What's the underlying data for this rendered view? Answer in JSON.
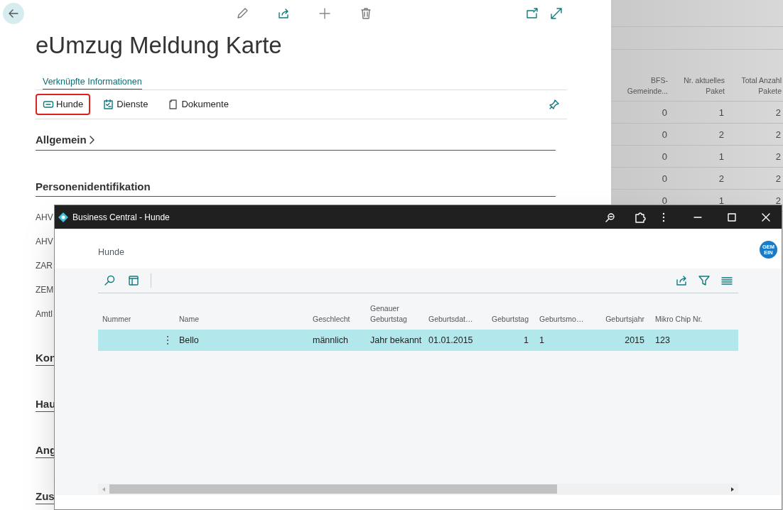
{
  "page": {
    "title": "eUmzug Meldung Karte",
    "related_link": "Verknüpfte Informationen",
    "actions": [
      {
        "label": "Hunde",
        "kind": "tag",
        "highlighted": true
      },
      {
        "label": "Dienste",
        "kind": "services",
        "highlighted": false
      },
      {
        "label": "Dokumente",
        "kind": "docs",
        "highlighted": false
      }
    ],
    "sections": [
      {
        "title": "Allgemein",
        "expandable": true
      },
      {
        "title": "Personenidentifikation",
        "expandable": false
      }
    ],
    "fields": [
      "AHV",
      "AHV",
      "ZAR",
      "ZEM",
      "Amtl"
    ],
    "more_sections": [
      "Kon",
      "Hau",
      "Ang",
      "Zus"
    ]
  },
  "background_list": {
    "columns": [
      "BFS-\nGemeinde...",
      "Nr. aktuelles\nPaket",
      "Total Anzahl\nPakete"
    ],
    "rows": [
      [
        "0",
        "1",
        "2"
      ],
      [
        "0",
        "2",
        "2"
      ],
      [
        "0",
        "1",
        "2"
      ],
      [
        "0",
        "2",
        "2"
      ],
      [
        "0",
        "1",
        "2"
      ]
    ]
  },
  "window": {
    "title": "Business Central - Hunde",
    "caption": "Hunde",
    "avatar": "GEM\nEIN",
    "table": {
      "columns": [
        "Nummer",
        "Name",
        "Geschlecht",
        "Genauer\nGeburtstag",
        "Geburtsdat…",
        "Geburtstag",
        "Geburtsmo…",
        "Geburtsjahr",
        "Mikro Chip Nr."
      ],
      "rows": [
        {
          "selected": true,
          "cells": [
            "",
            "Bello",
            "männlich",
            "Jahr bekannt",
            "01.01.2015",
            "1",
            "1",
            "2015",
            "123"
          ]
        }
      ]
    }
  }
}
